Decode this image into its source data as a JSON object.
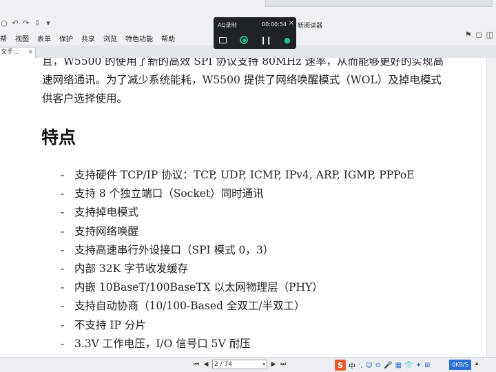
{
  "chrome": {
    "quick_access": [
      "○",
      "↶",
      "↷",
      "⇩",
      "▾"
    ],
    "menu": [
      "帮",
      "视图",
      "表单",
      "保护",
      "共享",
      "浏览",
      "特色功能",
      "帮助"
    ],
    "app_title_fragment": "新阅读器",
    "doc_tab": {
      "label": "文手...",
      "close": "×"
    },
    "right_icons": [
      "⚑",
      "◻",
      "◫"
    ]
  },
  "recorder": {
    "name": "AQ录制",
    "time": "00:00:54",
    "close": "×"
  },
  "document": {
    "paragraph_lines": [
      "且，W5500 的使用了新的高效 SPI 协议支持 80MHz 速率，从而能够更好的实现高",
      "速网络通讯。为了减少系统能耗，W5500 提供了网络唤醒模式（WOL）及掉电模式",
      "供客户选择使用。"
    ],
    "heading": "特点",
    "features": [
      "支持硬件 TCP/IP 协议：TCP, UDP, ICMP, IPv4, ARP, IGMP, PPPoE",
      "支持 8 个独立端口（Socket）同时通讯",
      "支持掉电模式",
      "支持网络唤醒",
      "支持高速串行外设接口（SPI 模式 0，3）",
      "内部 32K 字节收发缓存",
      "内嵌 10BaseT/100BaseTX 以太网物理层（PHY）",
      "支持自动协商（10/100-Based 全双工/半双工）",
      "不支持 IP 分片",
      "3.3V 工作电压，I/O 信号口 5V 耐压"
    ],
    "bullet": "-"
  },
  "pager": {
    "first": "⏮",
    "prev": "◀",
    "page": "2 / 74",
    "caret": "▾",
    "next": "▶",
    "last": "⏭"
  },
  "tray": {
    "ime": "S",
    "ime_mode": "中",
    "icons": [
      "·,",
      "☺",
      "⊙",
      "🎤",
      "▦",
      "👕",
      "✦",
      "⊞"
    ],
    "netspeed": "0KB/S",
    "end": "▴"
  }
}
